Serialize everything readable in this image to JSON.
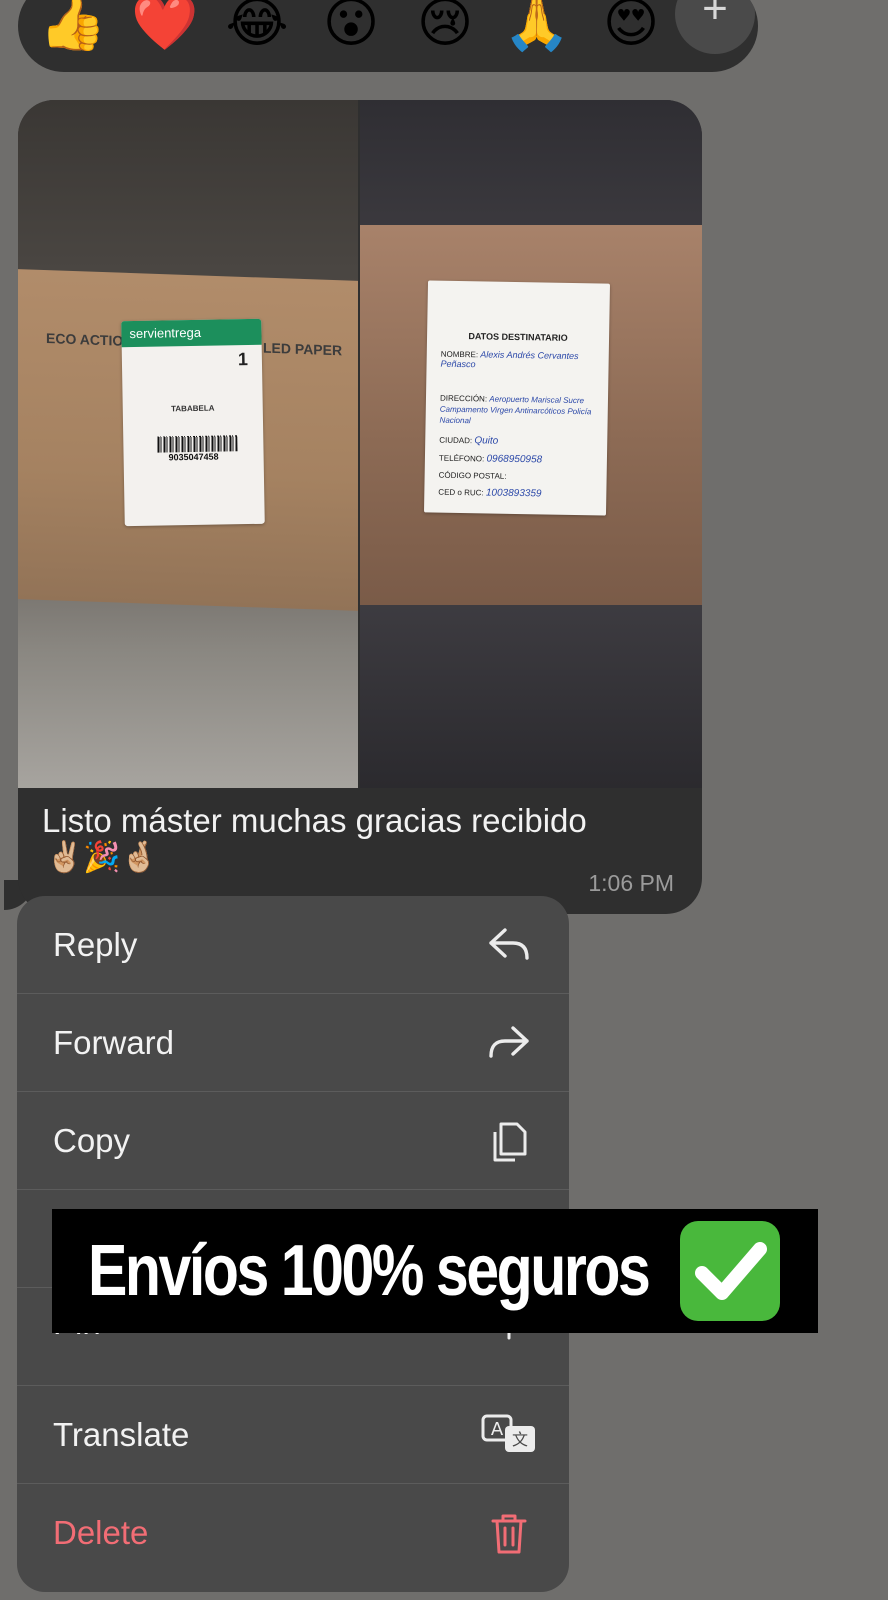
{
  "reactions": [
    {
      "name": "thumbs-up",
      "glyph": "👍"
    },
    {
      "name": "red-heart",
      "glyph": "❤️"
    },
    {
      "name": "laughing",
      "glyph": "😂"
    },
    {
      "name": "surprised",
      "glyph": "😮"
    },
    {
      "name": "crying",
      "glyph": "😢"
    },
    {
      "name": "praying-hands",
      "glyph": "🙏"
    },
    {
      "name": "heart-eyes",
      "glyph": "😍"
    }
  ],
  "reaction_more": "+",
  "message": {
    "text": "Listo máster muchas gracias recibido",
    "emojis": "✌🏼🎉🤞🏼",
    "time": "1:06 PM",
    "photo_left": {
      "brand": "servientrega",
      "box_text_1": "ECO ACTIONS",
      "box_text_2": "LED PAPER",
      "number": "1",
      "city": "TABABELA",
      "tracking": "9035047458"
    },
    "photo_right": {
      "title": "DATOS DESTINATARIO",
      "nombre_label": "NOMBRE:",
      "nombre": "Alexis Andrés Cervantes Peñasco",
      "direccion_label": "DIRECCIÓN:",
      "direccion": "Aeropuerto Mariscal Sucre Campamento Virgen Antinarcóticos Policía Nacional",
      "ciudad_label": "CIUDAD:",
      "ciudad": "Quito",
      "telefono_label": "TELÉFONO:",
      "telefono": "0968950958",
      "postal_label": "CÓDIGO POSTAL:",
      "ced_label": "CED o RUC:",
      "ced": "1003893359"
    }
  },
  "menu": {
    "items": [
      {
        "label": "Reply",
        "icon": "reply-icon"
      },
      {
        "label": "Forward",
        "icon": "forward-icon"
      },
      {
        "label": "Copy",
        "icon": "copy-icon"
      },
      {
        "label": "",
        "icon": ""
      },
      {
        "label": "Pin",
        "icon": "pin-icon"
      },
      {
        "label": "Translate",
        "icon": "translate-icon"
      },
      {
        "label": "Delete",
        "icon": "trash-icon"
      }
    ]
  },
  "banner": {
    "text": "Envíos 100% seguros",
    "check_glyph": "✔"
  },
  "colors": {
    "background": "#6f6e6c",
    "bubble": "#2f2f2f",
    "menu": "#494949",
    "danger": "#f26d75",
    "check": "#49b83c"
  }
}
